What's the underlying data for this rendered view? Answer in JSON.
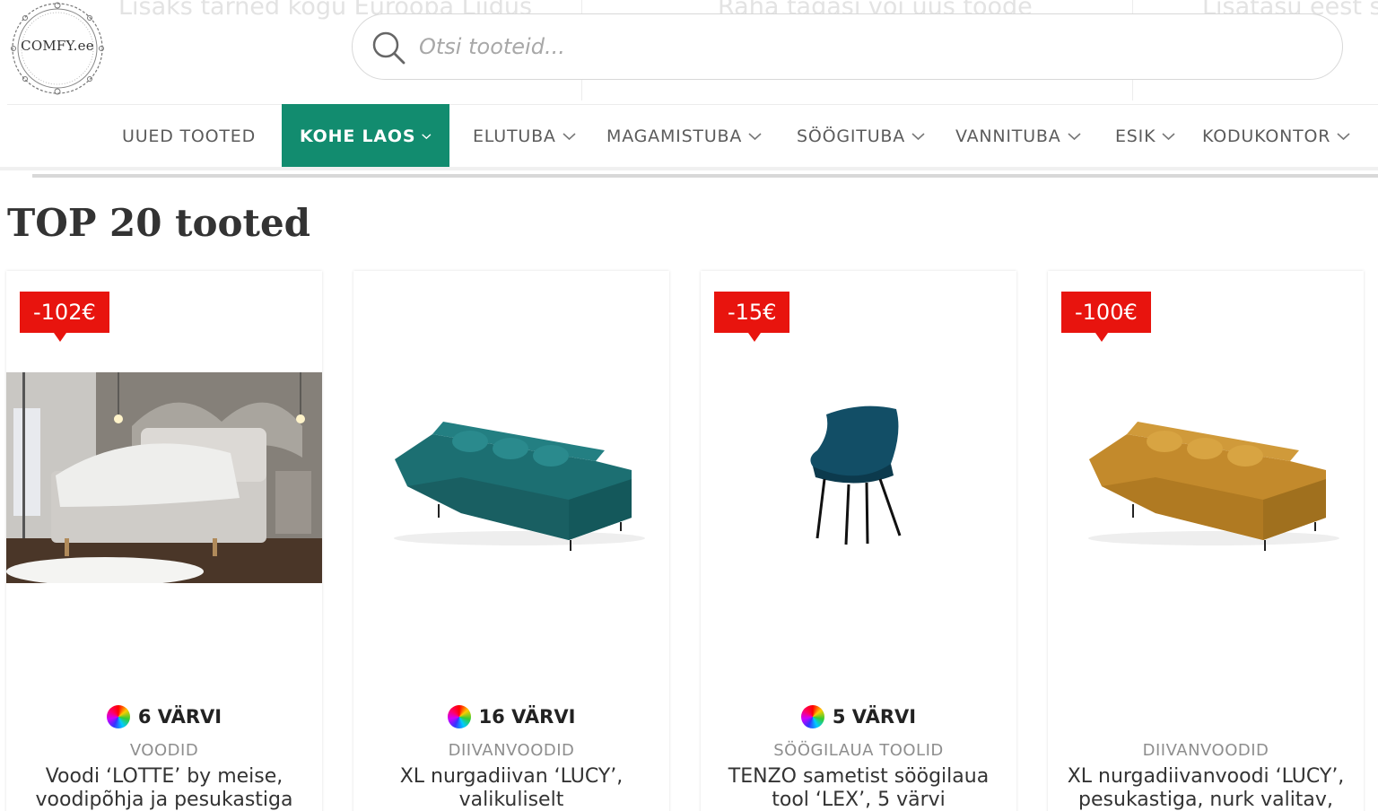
{
  "promo": {
    "item1": "Lisaks tarned kogu Euroopa Liidus",
    "item2": "Raha tagasi või uus toode",
    "item3": "Lisatasu eest sa"
  },
  "logo": {
    "text": "COMFY.ee"
  },
  "search": {
    "placeholder": "Otsi tooteid...",
    "icon": "search-icon"
  },
  "nav": {
    "items": [
      {
        "label": "UUED TOOTED",
        "dropdown": false
      },
      {
        "label": "KOHE LAOS",
        "dropdown": true,
        "active": true
      },
      {
        "label": "ELUTUBA",
        "dropdown": true
      },
      {
        "label": "MAGAMISTUBA",
        "dropdown": true
      },
      {
        "label": "SÖÖGITUBA",
        "dropdown": true
      },
      {
        "label": "VANNITUBA",
        "dropdown": true
      },
      {
        "label": "ESIK",
        "dropdown": true
      },
      {
        "label": "KODUKONTOR",
        "dropdown": true
      }
    ],
    "accent_color": "#128c6f"
  },
  "section": {
    "title": "TOP 20 tooted"
  },
  "badge_color": "#e8140e",
  "products": [
    {
      "badge": "-102€",
      "colors": "6 VÄRVI",
      "category": "VOODID",
      "name": "Voodi ‘LOTTE’ by meise, voodipõhja ja pesukastiga"
    },
    {
      "badge": "",
      "colors": "16 VÄRVI",
      "category": "DIIVANVOODID",
      "name": "XL nurgadiivan ‘LUCY’, valikuliselt"
    },
    {
      "badge": "-15€",
      "colors": "5 VÄRVI",
      "category": "SÖÖGILAUA TOOLID",
      "name": "TENZO sametist söögilaua tool ‘LEX’, 5 värvi"
    },
    {
      "badge": "-100€",
      "colors": "",
      "category": "DIIVANVOODID",
      "name": "XL nurgadiivanvoodi ‘LUCY’, pesukastiga, nurk valitav,"
    }
  ]
}
